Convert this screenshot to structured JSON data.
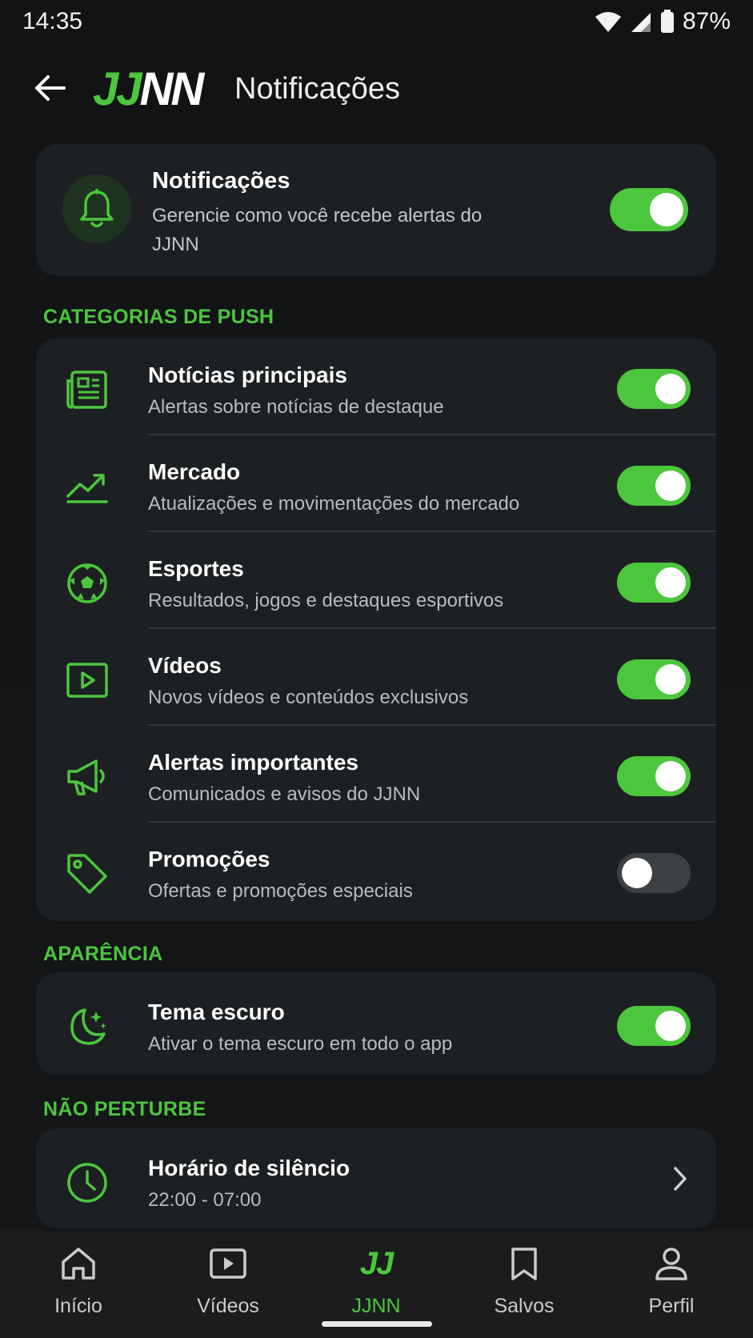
{
  "status_bar": {
    "time": "14:35",
    "battery": "87%"
  },
  "header": {
    "logo_jj": "JJ",
    "logo_nn": "NN",
    "title": "Notificações"
  },
  "main_card": {
    "title": "Notificações",
    "description": "Gerencie como você recebe alertas do JJNN",
    "enabled": true
  },
  "sections": {
    "push": "CATEGORIAS DE PUSH",
    "appearance": "APARÊNCIA",
    "dnd": "NÃO PERTURBE"
  },
  "push_categories": [
    {
      "icon": "newspaper-icon",
      "title": "Notícias principais",
      "description": "Alertas sobre notícias de destaque",
      "enabled": true
    },
    {
      "icon": "trending-up-icon",
      "title": "Mercado",
      "description": "Atualizações e movimentações do mercado",
      "enabled": true
    },
    {
      "icon": "soccer-ball-icon",
      "title": "Esportes",
      "description": "Resultados, jogos e destaques esportivos",
      "enabled": true
    },
    {
      "icon": "video-play-icon",
      "title": "Vídeos",
      "description": "Novos vídeos e conteúdos exclusivos",
      "enabled": true
    },
    {
      "icon": "megaphone-icon",
      "title": "Alertas importantes",
      "description": "Comunicados e avisos do JJNN",
      "enabled": true
    },
    {
      "icon": "tag-icon",
      "title": "Promoções",
      "description": "Ofertas e promoções especiais",
      "enabled": false
    }
  ],
  "appearance": {
    "icon": "moon-stars-icon",
    "title": "Tema escuro",
    "description": "Ativar o tema escuro em todo o app",
    "enabled": true
  },
  "dnd": {
    "icon": "clock-icon",
    "title": "Horário de silêncio",
    "value": "22:00 - 07:00"
  },
  "bottom_nav": [
    {
      "icon": "home-icon",
      "label": "Início",
      "active": false
    },
    {
      "icon": "video-icon",
      "label": "Vídeos",
      "active": false
    },
    {
      "icon": "jj-logo-icon",
      "icon_text": "JJ",
      "label": "JJNN",
      "active": true
    },
    {
      "icon": "bookmark-icon",
      "label": "Salvos",
      "active": false
    },
    {
      "icon": "person-icon",
      "label": "Perfil",
      "active": false
    }
  ],
  "colors": {
    "accent": "#4cc63d",
    "background": "#121416",
    "card": "#1d2022",
    "toggle_off": "#3d4043"
  }
}
